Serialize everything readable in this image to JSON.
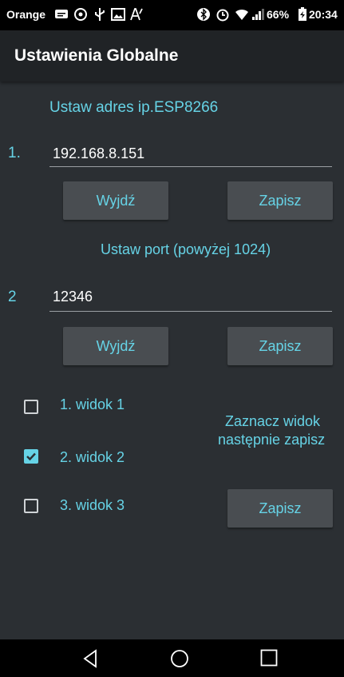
{
  "status_bar": {
    "carrier": "Orange",
    "battery": "66%",
    "time": "20:34",
    "icons": [
      "message-icon",
      "data-saver-icon",
      "usb-icon",
      "image-icon",
      "font-icon",
      "bluetooth-icon",
      "alarm-icon",
      "wifi-icon",
      "signal-icon",
      "battery-charging-icon"
    ]
  },
  "app_bar": {
    "title": "Ustawienia Globalne"
  },
  "ip_section": {
    "heading": "Ustaw adres ip.ESP8266",
    "index": "1.",
    "value": "192.168.8.151",
    "exit_label": "Wyjdź",
    "save_label": "Zapisz"
  },
  "port_section": {
    "heading": "Ustaw port (powyżej 1024)",
    "index": "2",
    "value": "12346",
    "exit_label": "Wyjdź",
    "save_label": "Zapisz"
  },
  "view_section": {
    "options": [
      {
        "label": "1. widok 1",
        "checked": false
      },
      {
        "label": "2. widok 2",
        "checked": true
      },
      {
        "label": "3. widok 3",
        "checked": false
      }
    ],
    "hint_line1": "Zaznacz widok",
    "hint_line2": "następnie zapisz",
    "save_label": "Zapisz"
  },
  "nav_bar": {
    "icons": [
      "back-icon",
      "home-icon",
      "recents-icon"
    ]
  },
  "colors": {
    "accent": "#66d3e6",
    "background": "#2b2f33",
    "button": "#494d51",
    "appbar": "#202326"
  }
}
